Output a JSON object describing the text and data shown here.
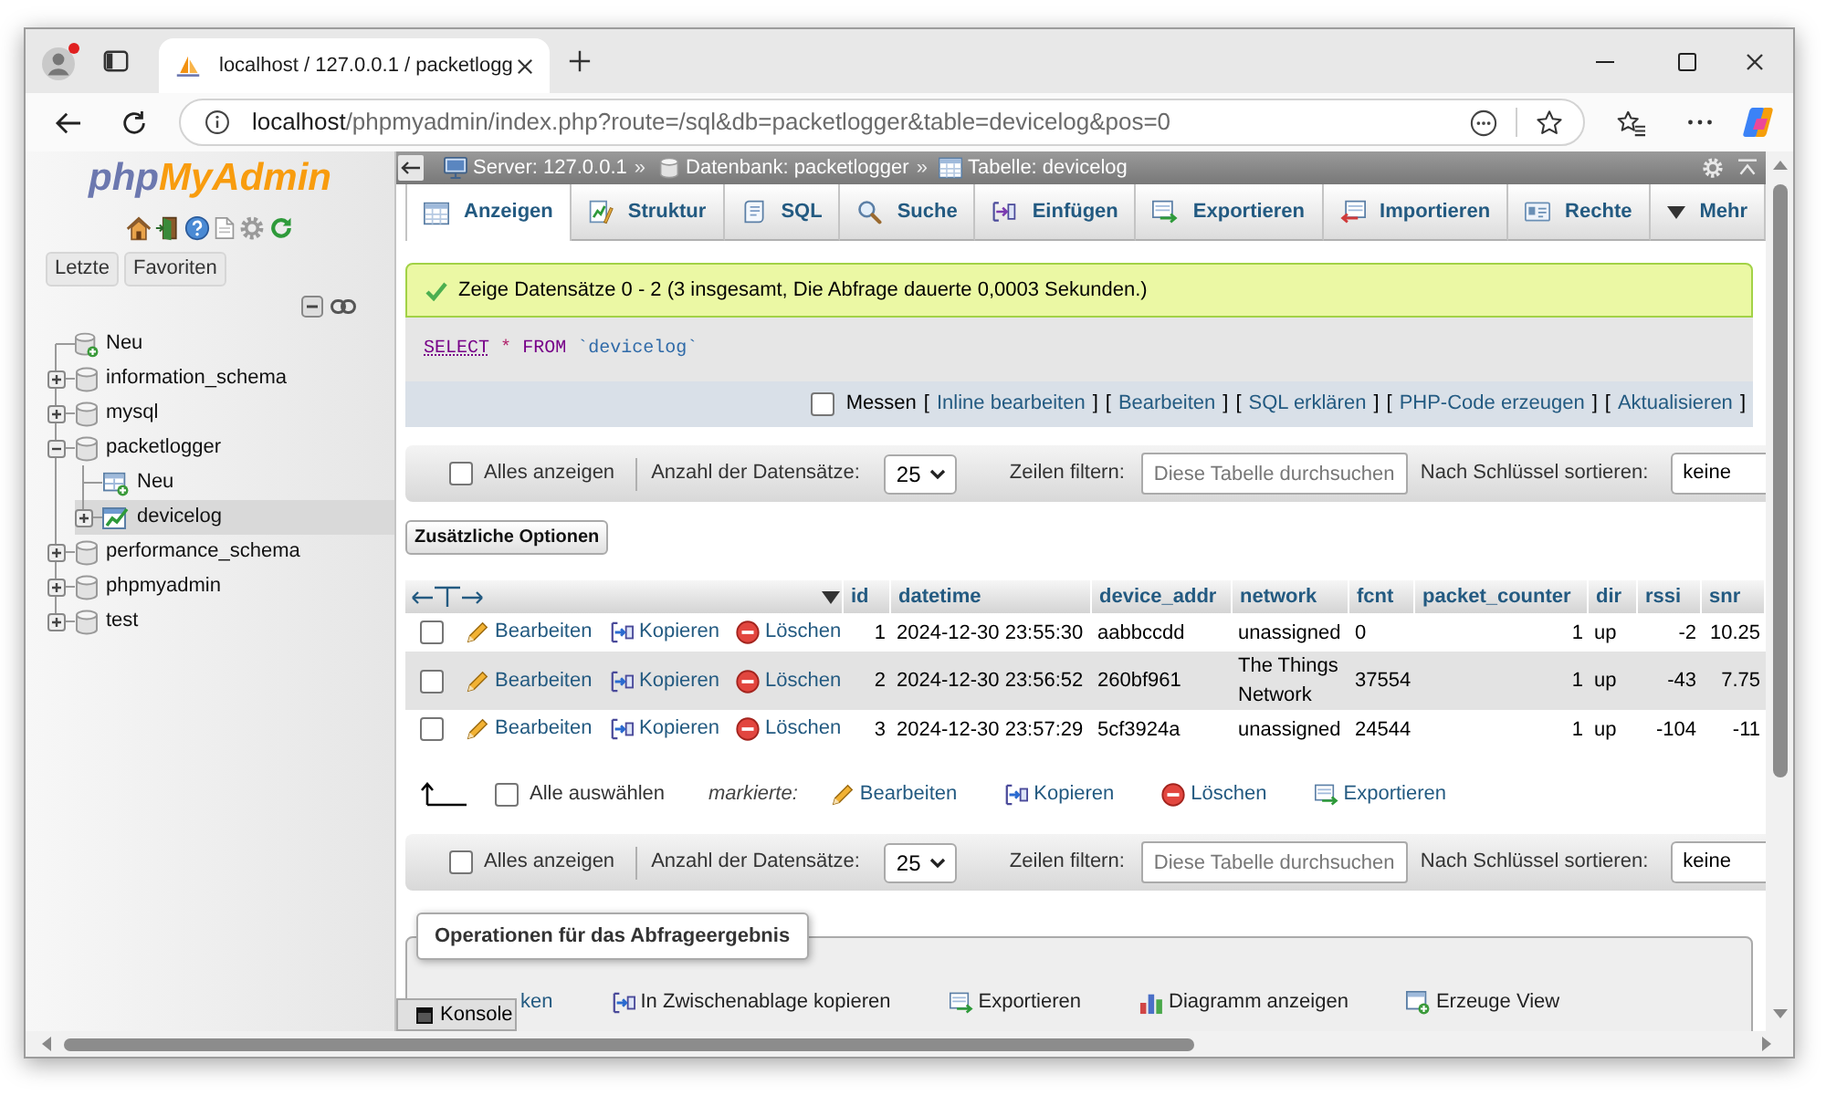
{
  "browser": {
    "tab": {
      "title": "localhost / 127.0.0.1 / packetlogg"
    },
    "address": {
      "host": "localhost",
      "path": "/phpmyadmin/index.php?route=/sql&db=packetlogger&table=devicelog&pos=0"
    }
  },
  "sidebar": {
    "logo": {
      "first": "php",
      "second": "MyAdmin"
    },
    "buttons": [
      "Letzte",
      "Favoriten"
    ],
    "tree": [
      {
        "kind": "new",
        "label": "Neu",
        "selected": false
      },
      {
        "kind": "database",
        "label": "information_schema",
        "expanded": false,
        "selected": false
      },
      {
        "kind": "database",
        "label": "mysql",
        "expanded": false,
        "selected": false
      },
      {
        "kind": "database",
        "label": "packetlogger",
        "expanded": true,
        "selected": false,
        "children": [
          {
            "kind": "new",
            "label": "Neu",
            "selected": false
          },
          {
            "kind": "table",
            "label": "devicelog",
            "expanded": false,
            "selected": true
          }
        ]
      },
      {
        "kind": "database",
        "label": "performance_schema",
        "expanded": false,
        "selected": false
      },
      {
        "kind": "database",
        "label": "phpmyadmin",
        "expanded": false,
        "selected": false
      },
      {
        "kind": "database",
        "label": "test",
        "expanded": false,
        "selected": false
      }
    ]
  },
  "breadcrumb": [
    {
      "kind": "server",
      "label": "Server: 127.0.0.1"
    },
    {
      "kind": "database",
      "separator": "»",
      "label": "Datenbank: packetlogger"
    },
    {
      "kind": "table",
      "separator": "»",
      "label": "Tabelle: devicelog"
    }
  ],
  "tabs": [
    {
      "kind": "browse",
      "label": "Anzeigen",
      "selected": true
    },
    {
      "kind": "structure",
      "label": "Struktur",
      "selected": false
    },
    {
      "kind": "sql",
      "label": "SQL",
      "selected": false
    },
    {
      "kind": "search",
      "label": "Suche",
      "selected": false
    },
    {
      "kind": "insert",
      "label": "Einfügen",
      "selected": false
    },
    {
      "kind": "export",
      "label": "Exportieren",
      "selected": false
    },
    {
      "kind": "import",
      "label": "Importieren",
      "selected": false
    },
    {
      "kind": "privileges",
      "label": "Rechte",
      "selected": false
    },
    {
      "kind": "more",
      "label": "Mehr",
      "selected": false
    }
  ],
  "message": {
    "kind": "success",
    "text": "Zeige Datensätze 0 - 2 (3 insgesamt, Die Abfrage dauerte 0,0003 Sekunden.)"
  },
  "query": [
    {
      "kind": "keyword",
      "text": "SELECT",
      "linked": true
    },
    {
      "kind": "operator",
      "text": "*"
    },
    {
      "kind": "keyword",
      "text": "FROM",
      "linked": false
    },
    {
      "kind": "identifier",
      "text": "`devicelog`"
    }
  ],
  "query_options": {
    "profiling": {
      "label": "Messen",
      "checked": false
    },
    "links": [
      {
        "open": "[",
        "label": "Inline bearbeiten",
        "close": "]"
      },
      {
        "open": "[",
        "label": "Bearbeiten",
        "close": "]"
      },
      {
        "open": "[",
        "label": "SQL erklären",
        "close": "]"
      },
      {
        "open": "[",
        "label": "PHP-Code erzeugen",
        "close": "]"
      },
      {
        "open": "[",
        "label": "Aktualisieren",
        "close": "]"
      }
    ]
  },
  "navigation": [
    {
      "show_all": {
        "label": "Alles anzeigen",
        "checked": false
      },
      "rows_label": "Anzahl der Datensätze:",
      "rows_value": "25",
      "filter_label": "Zeilen filtern:",
      "filter_placeholder": "Diese Tabelle durchsuchen",
      "sort_label": "Nach Schlüssel sortieren:",
      "sort_value": "keine"
    },
    {
      "show_all": {
        "label": "Alles anzeigen",
        "checked": false
      },
      "rows_label": "Anzahl der Datensätze:",
      "rows_value": "25",
      "filter_label": "Zeilen filtern:",
      "filter_placeholder": "Diese Tabelle durchsuchen",
      "sort_label": "Nach Schlüssel sortieren:",
      "sort_value": "keine"
    }
  ],
  "extra_options_button": "Zusätzliche Optionen",
  "table": {
    "columns": [
      {
        "label": "id",
        "kind": "number"
      },
      {
        "label": "datetime",
        "kind": "text"
      },
      {
        "label": "device_addr",
        "kind": "text"
      },
      {
        "label": "network",
        "kind": "text"
      },
      {
        "label": "fcnt",
        "kind": "text"
      },
      {
        "label": "packet_counter",
        "kind": "number"
      },
      {
        "label": "dir",
        "kind": "text"
      },
      {
        "label": "rssi",
        "kind": "number"
      },
      {
        "label": "snr",
        "kind": "number"
      }
    ],
    "rows": [
      {
        "checked": false,
        "actions": [
          {
            "kind": "edit",
            "label": "Bearbeiten"
          },
          {
            "kind": "copy",
            "label": "Kopieren"
          },
          {
            "kind": "delete",
            "label": "Löschen"
          }
        ],
        "cells": [
          "1",
          "2024-12-30 23:55:30",
          "aabbccdd",
          "unassigned",
          "0",
          "1",
          "up",
          "-2",
          "10.25"
        ]
      },
      {
        "checked": false,
        "actions": [
          {
            "kind": "edit",
            "label": "Bearbeiten"
          },
          {
            "kind": "copy",
            "label": "Kopieren"
          },
          {
            "kind": "delete",
            "label": "Löschen"
          }
        ],
        "cells": [
          "2",
          "2024-12-30 23:56:52",
          "260bf961",
          "The Things Network",
          "37554",
          "1",
          "up",
          "-43",
          "7.75"
        ]
      },
      {
        "checked": false,
        "actions": [
          {
            "kind": "edit",
            "label": "Bearbeiten"
          },
          {
            "kind": "copy",
            "label": "Kopieren"
          },
          {
            "kind": "delete",
            "label": "Löschen"
          }
        ],
        "cells": [
          "3",
          "2024-12-30 23:57:29",
          "5cf3924a",
          "unassigned",
          "24544",
          "1",
          "up",
          "-104",
          "-11"
        ]
      }
    ]
  },
  "bulk_actions": {
    "select_all": {
      "label": "Alle auswählen",
      "checked": false
    },
    "with_selected": "markierte:",
    "actions": [
      {
        "kind": "edit",
        "label": "Bearbeiten"
      },
      {
        "kind": "copy",
        "label": "Kopieren"
      },
      {
        "kind": "delete",
        "label": "Löschen"
      },
      {
        "kind": "export",
        "label": "Exportieren"
      }
    ]
  },
  "operations": {
    "title": "Operationen für das Abfrageergebnis",
    "actions": [
      {
        "kind": "print",
        "label": "ken"
      },
      {
        "kind": "copy",
        "label": "In Zwischenablage kopieren"
      },
      {
        "kind": "export",
        "label": "Exportieren"
      },
      {
        "kind": "chart",
        "label": "Diagramm anzeigen"
      },
      {
        "kind": "view",
        "label": "Erzeuge View"
      }
    ]
  },
  "console": {
    "label": "Konsole"
  }
}
